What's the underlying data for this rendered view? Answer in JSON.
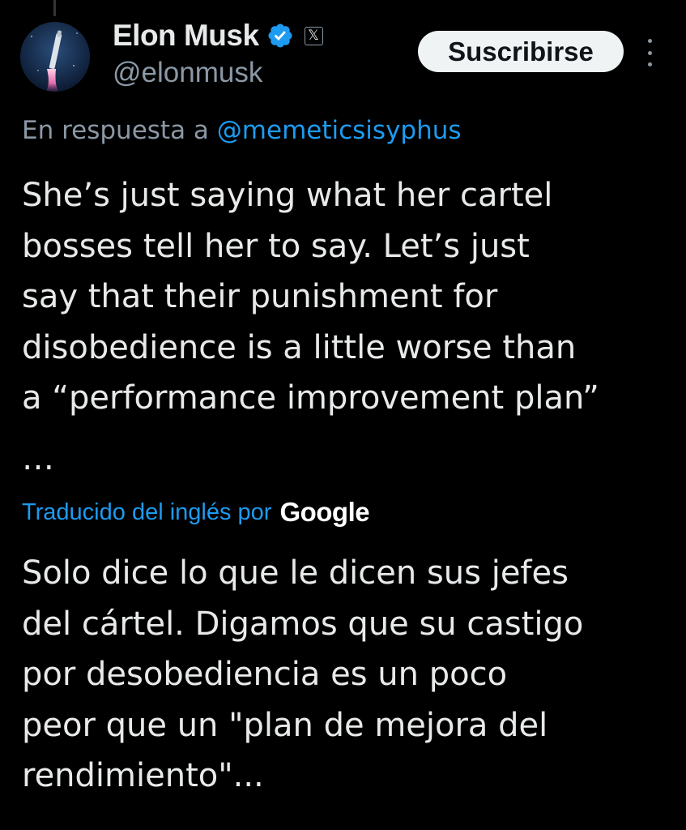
{
  "author": {
    "display_name": "Elon Musk",
    "handle": "@elonmusk",
    "verified_icon": "verified-badge-icon",
    "affiliate_icon": "x-logo-icon",
    "affiliate_glyph": "𝕏"
  },
  "actions": {
    "subscribe_label": "Suscribirse",
    "more_icon": "more-options-icon"
  },
  "reply_context": {
    "prefix": "En respuesta a",
    "mention": "@memeticsisyphus"
  },
  "tweet": {
    "original_lines": [
      "She’s just saying what her cartel",
      "bosses tell her to say. Let’s just",
      "say that their punishment for",
      "disobedience is a little worse than",
      "a “performance improvement plan”"
    ],
    "ellipsis": "…",
    "translation_label": "Traducido del inglés por",
    "translation_provider": "Google",
    "translated_lines": [
      "Solo dice lo que le dicen sus jefes",
      "del cártel. Digamos que su castigo",
      "por desobediencia es un poco",
      "peor que un \"plan de mejora del",
      "rendimiento\"..."
    ]
  },
  "colors": {
    "background": "#000000",
    "text_primary": "#e7e9ea",
    "text_secondary": "#8b98a5",
    "accent_blue": "#1d9bf0",
    "button_bg": "#eff3f4"
  }
}
